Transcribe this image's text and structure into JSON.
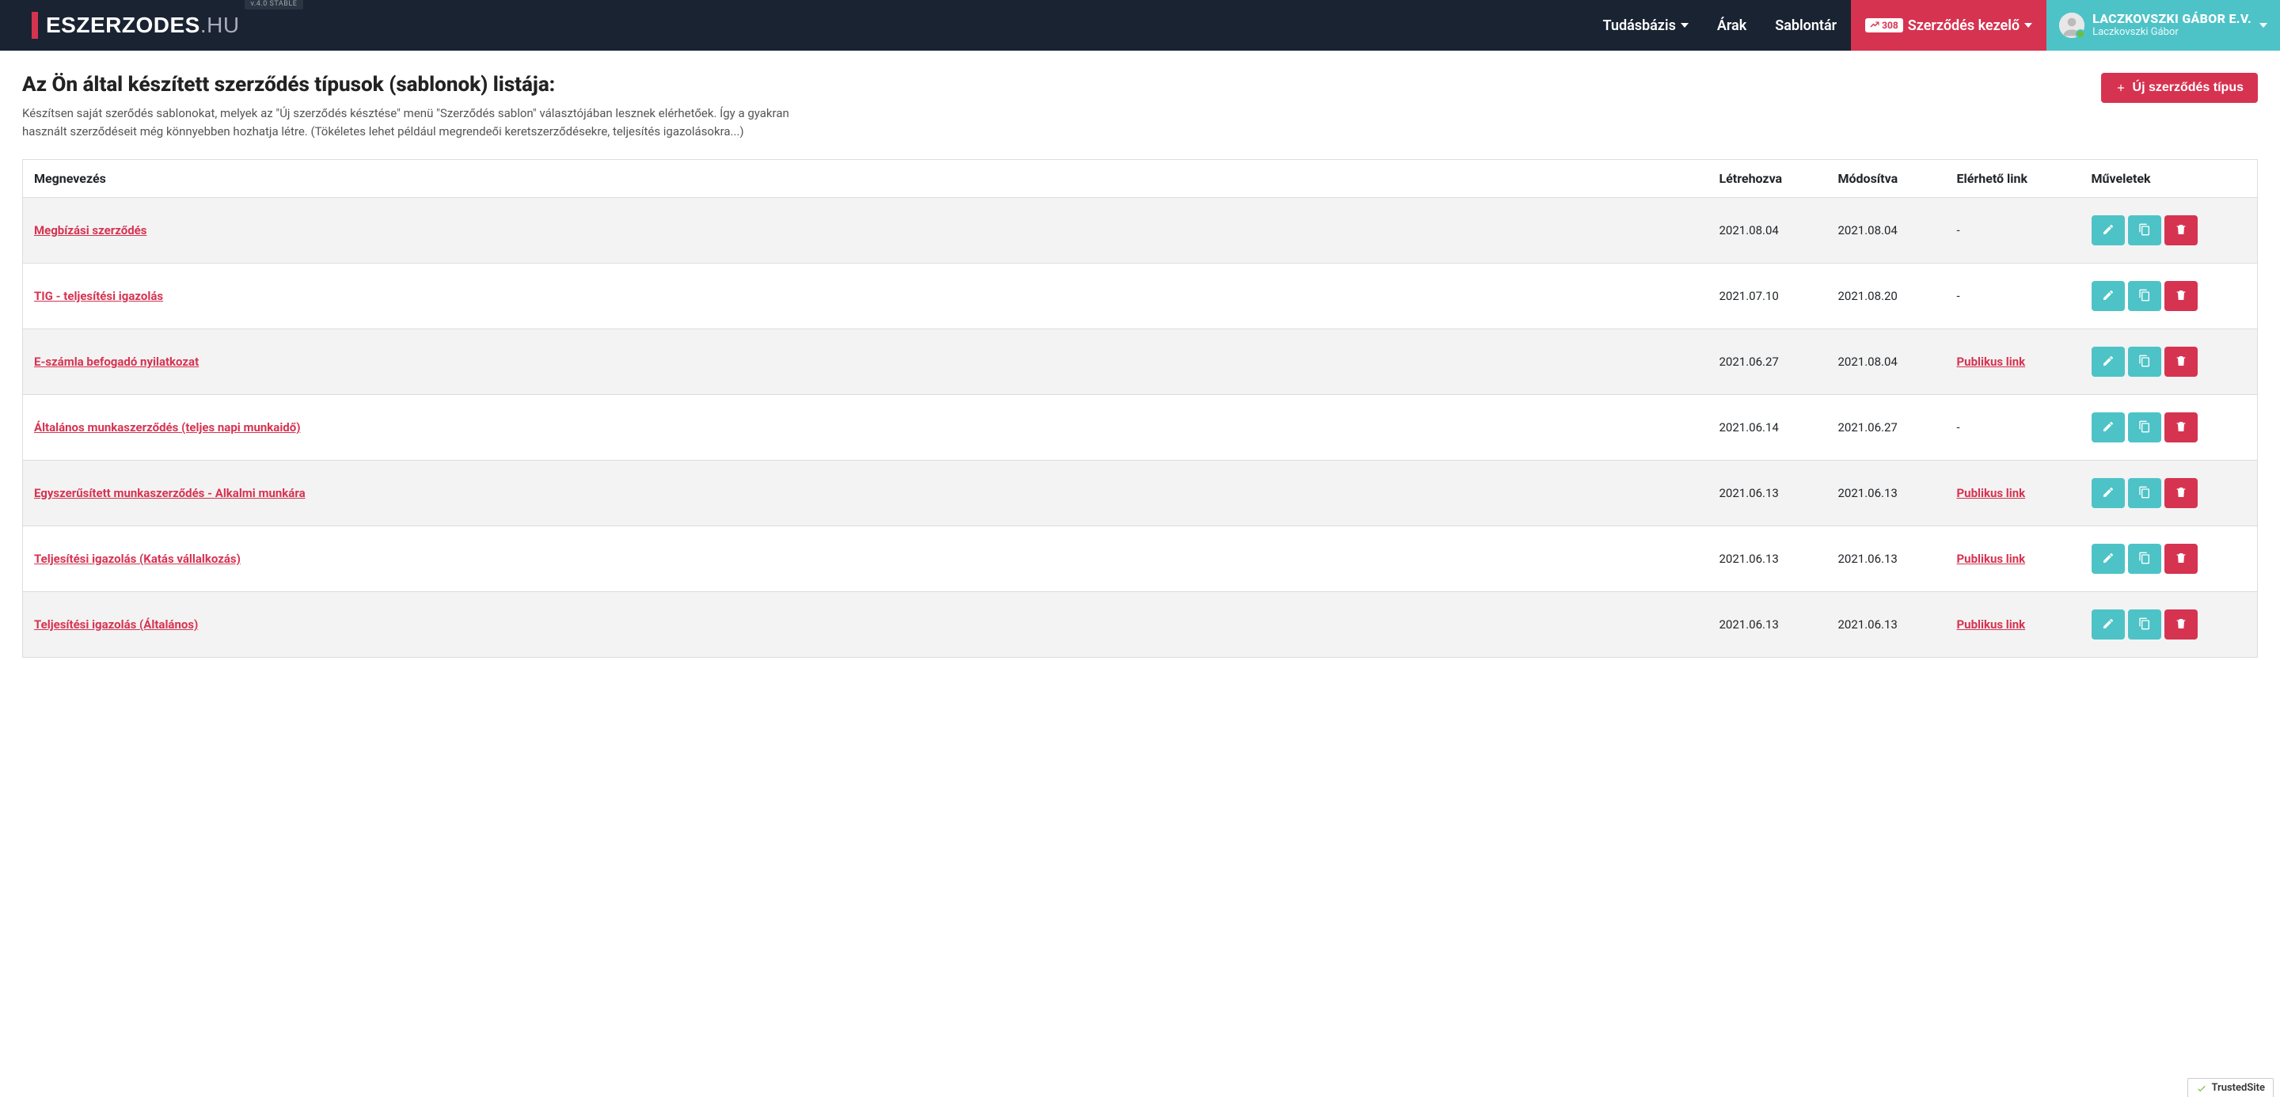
{
  "header": {
    "logo_main": "ESZERZODES",
    "logo_suffix": ".HU",
    "version": "v.4.0 STABLE",
    "nav": {
      "knowledge": "Tudásbázis",
      "prices": "Árak",
      "templates": "Sablontár",
      "count": "308",
      "manager": "Szerződés kezelő"
    },
    "user": {
      "name": "LACZKOVSZKI GÁBOR E.V.",
      "sub": "Laczkovszki Gábor"
    }
  },
  "page": {
    "title": "Az Ön által készített szerződés típusok (sablonok) listája:",
    "desc": "Készítsen saját szerődés sablonokat, melyek az \"Új szerződés késztése\" menü \"Szerződés sablon\" választójában lesznek elérhetőek. Így a gyakran használt szerződéseit még könnyebben hozhatja létre. (Tökéletes lehet például megrendeői keretszerződésekre, teljesítés igazolásokra...)",
    "new_btn": "Új szerződés típus"
  },
  "table": {
    "cols": {
      "name": "Megnevezés",
      "created": "Létrehozva",
      "modified": "Módosítva",
      "link": "Elérhető link",
      "actions": "Műveletek"
    },
    "public_link_label": "Publikus link",
    "rows": [
      {
        "name": "Megbízási szerződés",
        "created": "2021.08.04",
        "modified": "2021.08.04",
        "link": ""
      },
      {
        "name": "TIG - teljesítési igazolás",
        "created": "2021.07.10",
        "modified": "2021.08.20",
        "link": ""
      },
      {
        "name": "E-számla befogadó nyilatkozat",
        "created": "2021.06.27",
        "modified": "2021.08.04",
        "link": "public"
      },
      {
        "name": "Általános munkaszerződés (teljes napi munkaidő)",
        "created": "2021.06.14",
        "modified": "2021.06.27",
        "link": ""
      },
      {
        "name": "Egyszerűsített munkaszerződés - Alkalmi munkára",
        "created": "2021.06.13",
        "modified": "2021.06.13",
        "link": "public"
      },
      {
        "name": "Teljesítési igazolás (Katás vállalkozás)",
        "created": "2021.06.13",
        "modified": "2021.06.13",
        "link": "public"
      },
      {
        "name": "Teljesítési igazolás (Általános)",
        "created": "2021.06.13",
        "modified": "2021.06.13",
        "link": "public"
      }
    ]
  },
  "trusted": "TrustedSite"
}
